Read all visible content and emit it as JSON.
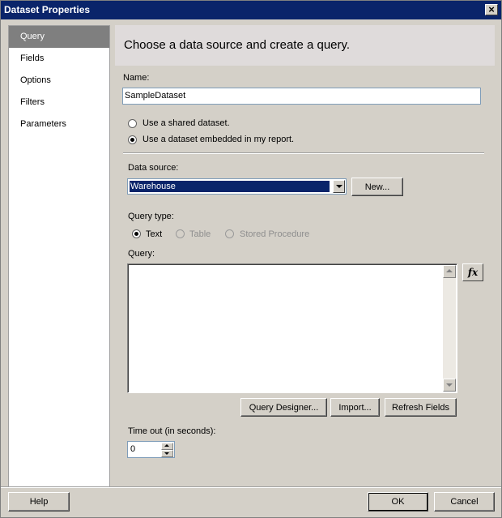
{
  "window": {
    "title": "Dataset Properties",
    "close_glyph": "×"
  },
  "nav": {
    "items": [
      {
        "label": "Query",
        "selected": true
      },
      {
        "label": "Fields"
      },
      {
        "label": "Options"
      },
      {
        "label": "Filters"
      },
      {
        "label": "Parameters"
      }
    ]
  },
  "header": {
    "text": "Choose a data source and create a query."
  },
  "name_field": {
    "label": "Name:",
    "value": "SampleDataset"
  },
  "dataset_choice": {
    "shared_label": "Use a shared dataset.",
    "embedded_label": "Use a dataset embedded in my report.",
    "selected": "embedded"
  },
  "data_source": {
    "label": "Data source:",
    "value": "Warehouse",
    "new_button": "New..."
  },
  "query_type": {
    "label": "Query type:",
    "options": [
      "Text",
      "Table",
      "Stored Procedure"
    ],
    "selected": "Text"
  },
  "query": {
    "label": "Query:",
    "value": "",
    "fx_label": "fx"
  },
  "query_buttons": {
    "designer": "Query Designer...",
    "import": "Import...",
    "refresh": "Refresh Fields"
  },
  "timeout": {
    "label": "Time out (in seconds):",
    "value": "0"
  },
  "footer": {
    "help": "Help",
    "ok": "OK",
    "cancel": "Cancel"
  },
  "colors": {
    "titlebar": "#0a246a",
    "selection": "#0a246a",
    "nav_selected": "#7f7f7f",
    "dialog": "#d4d0c8"
  }
}
